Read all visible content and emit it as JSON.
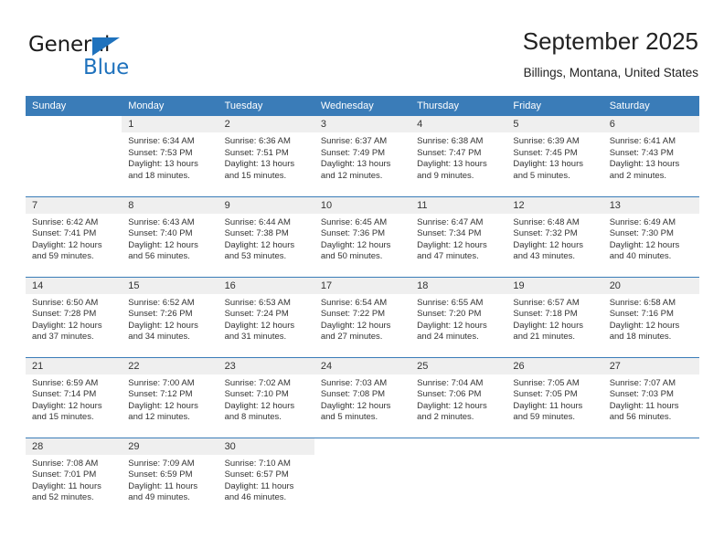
{
  "brand": {
    "name_top": "General",
    "name_bottom": "Blue",
    "accent_color": "#1f72bd"
  },
  "header": {
    "title": "September 2025",
    "subtitle": "Billings, Montana, United States"
  },
  "theme": {
    "header_bg": "#3a7cb8",
    "daynum_bg": "#efefef",
    "rule_color": "#3a7cb8",
    "text_color": "#333333"
  },
  "weekdays": [
    "Sunday",
    "Monday",
    "Tuesday",
    "Wednesday",
    "Thursday",
    "Friday",
    "Saturday"
  ],
  "weeks": [
    [
      {
        "day": "",
        "lines": []
      },
      {
        "day": "1",
        "lines": [
          "Sunrise: 6:34 AM",
          "Sunset: 7:53 PM",
          "Daylight: 13 hours",
          "and 18 minutes."
        ]
      },
      {
        "day": "2",
        "lines": [
          "Sunrise: 6:36 AM",
          "Sunset: 7:51 PM",
          "Daylight: 13 hours",
          "and 15 minutes."
        ]
      },
      {
        "day": "3",
        "lines": [
          "Sunrise: 6:37 AM",
          "Sunset: 7:49 PM",
          "Daylight: 13 hours",
          "and 12 minutes."
        ]
      },
      {
        "day": "4",
        "lines": [
          "Sunrise: 6:38 AM",
          "Sunset: 7:47 PM",
          "Daylight: 13 hours",
          "and 9 minutes."
        ]
      },
      {
        "day": "5",
        "lines": [
          "Sunrise: 6:39 AM",
          "Sunset: 7:45 PM",
          "Daylight: 13 hours",
          "and 5 minutes."
        ]
      },
      {
        "day": "6",
        "lines": [
          "Sunrise: 6:41 AM",
          "Sunset: 7:43 PM",
          "Daylight: 13 hours",
          "and 2 minutes."
        ]
      }
    ],
    [
      {
        "day": "7",
        "lines": [
          "Sunrise: 6:42 AM",
          "Sunset: 7:41 PM",
          "Daylight: 12 hours",
          "and 59 minutes."
        ]
      },
      {
        "day": "8",
        "lines": [
          "Sunrise: 6:43 AM",
          "Sunset: 7:40 PM",
          "Daylight: 12 hours",
          "and 56 minutes."
        ]
      },
      {
        "day": "9",
        "lines": [
          "Sunrise: 6:44 AM",
          "Sunset: 7:38 PM",
          "Daylight: 12 hours",
          "and 53 minutes."
        ]
      },
      {
        "day": "10",
        "lines": [
          "Sunrise: 6:45 AM",
          "Sunset: 7:36 PM",
          "Daylight: 12 hours",
          "and 50 minutes."
        ]
      },
      {
        "day": "11",
        "lines": [
          "Sunrise: 6:47 AM",
          "Sunset: 7:34 PM",
          "Daylight: 12 hours",
          "and 47 minutes."
        ]
      },
      {
        "day": "12",
        "lines": [
          "Sunrise: 6:48 AM",
          "Sunset: 7:32 PM",
          "Daylight: 12 hours",
          "and 43 minutes."
        ]
      },
      {
        "day": "13",
        "lines": [
          "Sunrise: 6:49 AM",
          "Sunset: 7:30 PM",
          "Daylight: 12 hours",
          "and 40 minutes."
        ]
      }
    ],
    [
      {
        "day": "14",
        "lines": [
          "Sunrise: 6:50 AM",
          "Sunset: 7:28 PM",
          "Daylight: 12 hours",
          "and 37 minutes."
        ]
      },
      {
        "day": "15",
        "lines": [
          "Sunrise: 6:52 AM",
          "Sunset: 7:26 PM",
          "Daylight: 12 hours",
          "and 34 minutes."
        ]
      },
      {
        "day": "16",
        "lines": [
          "Sunrise: 6:53 AM",
          "Sunset: 7:24 PM",
          "Daylight: 12 hours",
          "and 31 minutes."
        ]
      },
      {
        "day": "17",
        "lines": [
          "Sunrise: 6:54 AM",
          "Sunset: 7:22 PM",
          "Daylight: 12 hours",
          "and 27 minutes."
        ]
      },
      {
        "day": "18",
        "lines": [
          "Sunrise: 6:55 AM",
          "Sunset: 7:20 PM",
          "Daylight: 12 hours",
          "and 24 minutes."
        ]
      },
      {
        "day": "19",
        "lines": [
          "Sunrise: 6:57 AM",
          "Sunset: 7:18 PM",
          "Daylight: 12 hours",
          "and 21 minutes."
        ]
      },
      {
        "day": "20",
        "lines": [
          "Sunrise: 6:58 AM",
          "Sunset: 7:16 PM",
          "Daylight: 12 hours",
          "and 18 minutes."
        ]
      }
    ],
    [
      {
        "day": "21",
        "lines": [
          "Sunrise: 6:59 AM",
          "Sunset: 7:14 PM",
          "Daylight: 12 hours",
          "and 15 minutes."
        ]
      },
      {
        "day": "22",
        "lines": [
          "Sunrise: 7:00 AM",
          "Sunset: 7:12 PM",
          "Daylight: 12 hours",
          "and 12 minutes."
        ]
      },
      {
        "day": "23",
        "lines": [
          "Sunrise: 7:02 AM",
          "Sunset: 7:10 PM",
          "Daylight: 12 hours",
          "and 8 minutes."
        ]
      },
      {
        "day": "24",
        "lines": [
          "Sunrise: 7:03 AM",
          "Sunset: 7:08 PM",
          "Daylight: 12 hours",
          "and 5 minutes."
        ]
      },
      {
        "day": "25",
        "lines": [
          "Sunrise: 7:04 AM",
          "Sunset: 7:06 PM",
          "Daylight: 12 hours",
          "and 2 minutes."
        ]
      },
      {
        "day": "26",
        "lines": [
          "Sunrise: 7:05 AM",
          "Sunset: 7:05 PM",
          "Daylight: 11 hours",
          "and 59 minutes."
        ]
      },
      {
        "day": "27",
        "lines": [
          "Sunrise: 7:07 AM",
          "Sunset: 7:03 PM",
          "Daylight: 11 hours",
          "and 56 minutes."
        ]
      }
    ],
    [
      {
        "day": "28",
        "lines": [
          "Sunrise: 7:08 AM",
          "Sunset: 7:01 PM",
          "Daylight: 11 hours",
          "and 52 minutes."
        ]
      },
      {
        "day": "29",
        "lines": [
          "Sunrise: 7:09 AM",
          "Sunset: 6:59 PM",
          "Daylight: 11 hours",
          "and 49 minutes."
        ]
      },
      {
        "day": "30",
        "lines": [
          "Sunrise: 7:10 AM",
          "Sunset: 6:57 PM",
          "Daylight: 11 hours",
          "and 46 minutes."
        ]
      },
      {
        "day": "",
        "lines": []
      },
      {
        "day": "",
        "lines": []
      },
      {
        "day": "",
        "lines": []
      },
      {
        "day": "",
        "lines": []
      }
    ]
  ]
}
